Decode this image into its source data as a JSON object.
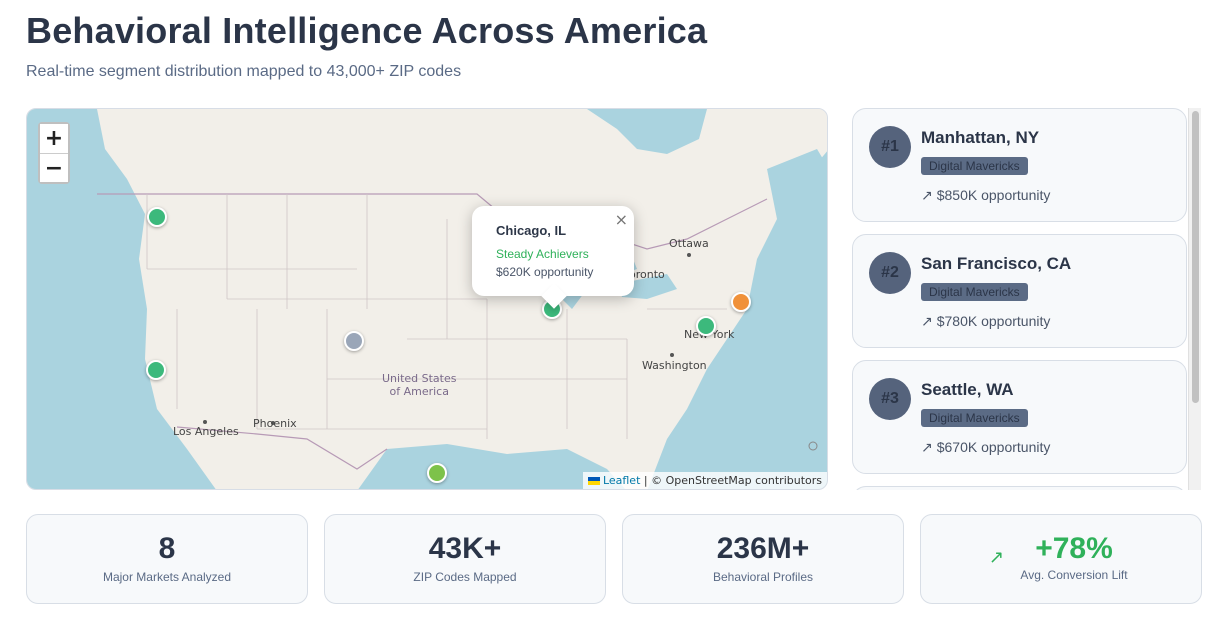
{
  "header": {
    "title": "Behavioral Intelligence Across America",
    "subtitle": "Real-time segment distribution mapped to 43,000+ ZIP codes"
  },
  "map": {
    "zoom_in": "+",
    "zoom_out": "−",
    "popup": {
      "title": "Chicago, IL",
      "segment": "Steady Achievers",
      "opportunity": "$620K opportunity",
      "close": "×"
    },
    "labels": {
      "ottawa": "Ottawa",
      "toronto": "oronto",
      "new_york": "New York",
      "washington": "Washington",
      "country": "United States\nof America",
      "country_line1": "United States",
      "country_line2": "of America",
      "phoenix": "Phoenix",
      "los_angeles": "Los Angeles"
    },
    "attribution": {
      "leaflet": "Leaflet",
      "rest": "| © OpenStreetMap contributors"
    },
    "marker_colors": {
      "green": "#3cb97c",
      "orange": "#f0913a",
      "gray": "#9aa6b8",
      "lime": "#7dc24a"
    }
  },
  "markets": [
    {
      "rank": "#1",
      "city": "Manhattan, NY",
      "segment": "Digital Mavericks",
      "opportunity": "$850K opportunity"
    },
    {
      "rank": "#2",
      "city": "San Francisco, CA",
      "segment": "Digital Mavericks",
      "opportunity": "$780K opportunity"
    },
    {
      "rank": "#3",
      "city": "Seattle, WA",
      "segment": "Digital Mavericks",
      "opportunity": "$670K opportunity"
    }
  ],
  "stats": [
    {
      "value": "8",
      "label": "Major Markets Analyzed"
    },
    {
      "value": "43K+",
      "label": "ZIP Codes Mapped"
    },
    {
      "value": "236M+",
      "label": "Behavioral Profiles"
    },
    {
      "value": "+78%",
      "label": "Avg. Conversion Lift"
    }
  ]
}
